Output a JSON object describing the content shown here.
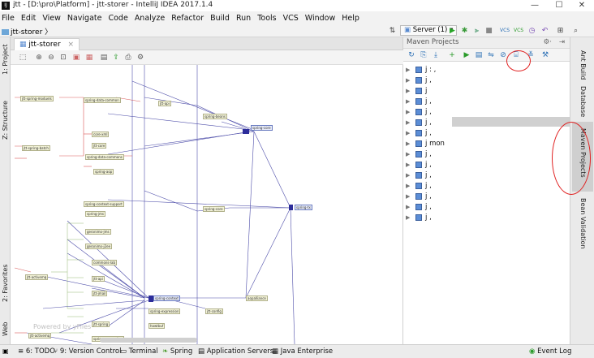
{
  "window": {
    "title": "jtt - [D:\\pro\\Platform] - jtt-storer - IntelliJ IDEA 2017.1.4",
    "logo": "IJ",
    "minimize": "—",
    "maximize": "☐",
    "close": "✕"
  },
  "menu": [
    "File",
    "Edit",
    "View",
    "Navigate",
    "Code",
    "Analyze",
    "Refactor",
    "Build",
    "Run",
    "Tools",
    "VCS",
    "Window",
    "Help"
  ],
  "navbar": {
    "breadcrumb": "jtt-storer",
    "run_config": "Server (1)"
  },
  "editor": {
    "tab_label": "jtt-storer",
    "watermark": "Powered by yFiles"
  },
  "left_tabs": [
    "1: Project",
    "Z: Structure",
    "2: Favorites",
    "Web"
  ],
  "right_tabs": [
    "Ant Build",
    "Database",
    "Maven Projects",
    "Bean Validation"
  ],
  "maven": {
    "title": "Maven Projects",
    "rows": [
      {
        "label": "j   : ,"
      },
      {
        "label": "j   ,"
      },
      {
        "label": "j  "
      },
      {
        "label": "j   ,"
      },
      {
        "label": "j   ,"
      },
      {
        "label": "j   ,"
      },
      {
        "label": "j  ,"
      },
      {
        "label": "j       mon"
      },
      {
        "label": "j   ,"
      },
      {
        "label": "j   ,"
      },
      {
        "label": "j   ,"
      },
      {
        "label": "j   ,"
      },
      {
        "label": "j   ,"
      },
      {
        "label": "j  ,"
      },
      {
        "label": "j   ,"
      }
    ]
  },
  "status_bar": {
    "todo": "6: TODO",
    "vcs": "9: Version Control",
    "terminal": "Terminal",
    "spring": "Spring",
    "app_servers": "Application Servers",
    "java_ee": "Java Enterprise",
    "event_log": "Event Log"
  },
  "diagram_nodes": [
    "jtt-spring-moduels",
    "spring-data-common",
    "jtt-api",
    "jtt-spring-batch",
    "spring-beans",
    "core-xml",
    "spring-data-commons",
    "jtt-core",
    "spring-aop",
    "spring-context-support",
    "spring-core",
    "spring-core",
    "jtt-activemq",
    "spring-jms",
    "geronimo-jms",
    "geronimo-j2ee",
    "commons-lab",
    "jtt-api",
    "jtt-jmail",
    "jtt-activemq",
    "spring-context",
    "spring-expression",
    "jtt-spring",
    "spring-messaging",
    "hawtbuf",
    "jtt-config",
    "aopalliance",
    "spring-tx"
  ]
}
